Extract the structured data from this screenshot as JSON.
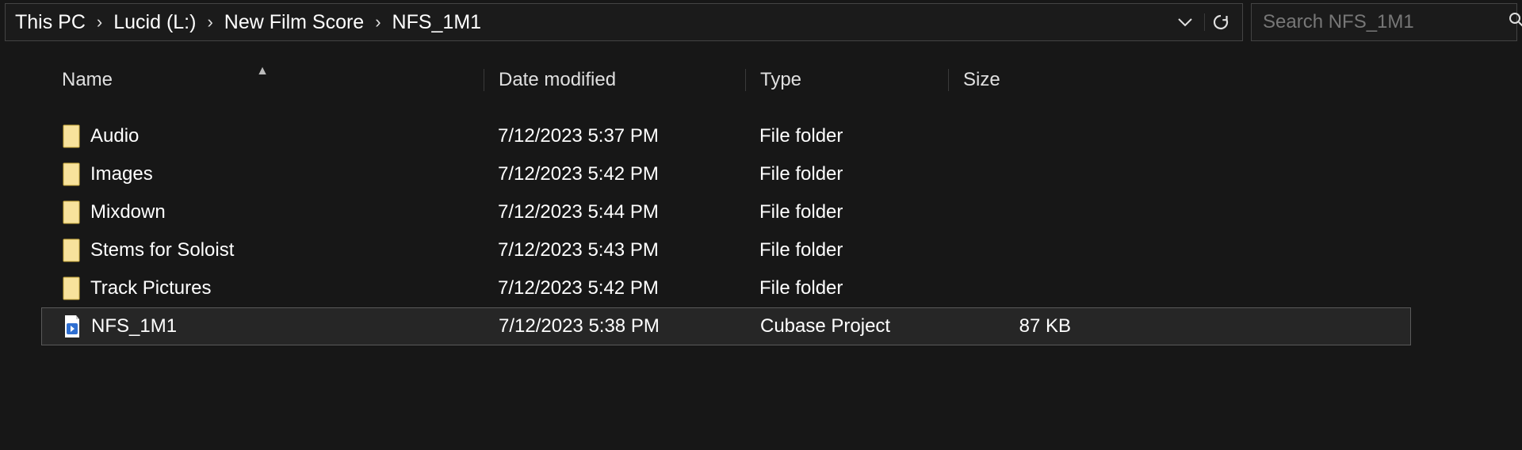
{
  "breadcrumb": [
    "This PC",
    "Lucid (L:)",
    "New Film Score",
    "NFS_1M1"
  ],
  "search": {
    "placeholder": "Search NFS_1M1"
  },
  "columns": {
    "name": "Name",
    "date": "Date modified",
    "type": "Type",
    "size": "Size"
  },
  "rows": [
    {
      "icon": "folder",
      "name": "Audio",
      "date": "7/12/2023 5:37 PM",
      "type": "File folder",
      "size": "",
      "selected": false
    },
    {
      "icon": "folder",
      "name": "Images",
      "date": "7/12/2023 5:42 PM",
      "type": "File folder",
      "size": "",
      "selected": false
    },
    {
      "icon": "folder",
      "name": "Mixdown",
      "date": "7/12/2023 5:44 PM",
      "type": "File folder",
      "size": "",
      "selected": false
    },
    {
      "icon": "folder",
      "name": "Stems for Soloist",
      "date": "7/12/2023 5:43 PM",
      "type": "File folder",
      "size": "",
      "selected": false
    },
    {
      "icon": "folder",
      "name": "Track Pictures",
      "date": "7/12/2023 5:42 PM",
      "type": "File folder",
      "size": "",
      "selected": false
    },
    {
      "icon": "cubase",
      "name": "NFS_1M1",
      "date": "7/12/2023 5:38 PM",
      "type": "Cubase Project",
      "size": "87 KB",
      "selected": true
    }
  ]
}
